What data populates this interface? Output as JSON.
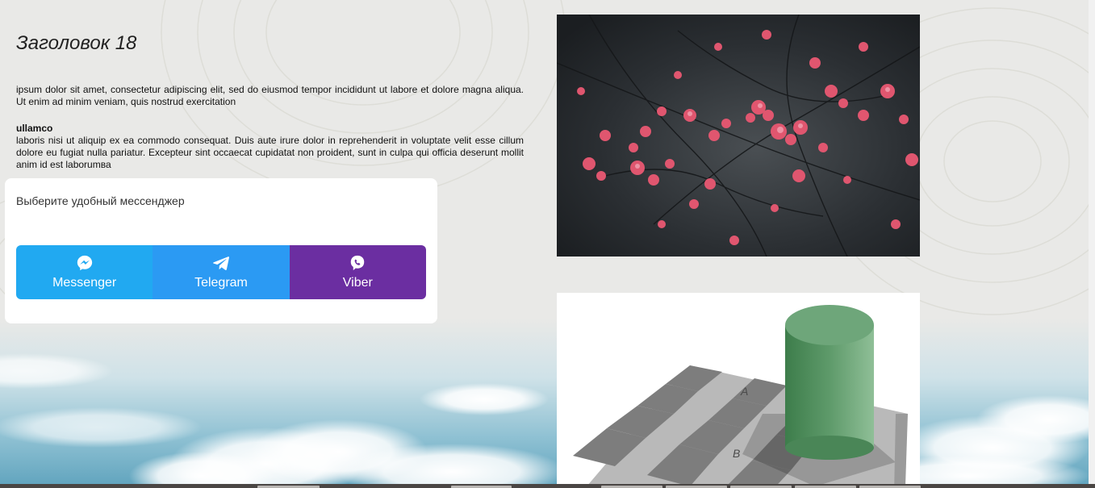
{
  "page": {
    "heading": "Заголовок 18",
    "paragraph1": "ipsum dolor sit amet, consectetur adipiscing elit, sed do eiusmod tempor incididunt ut labore et dolore magna aliqua. Ut enim ad minim veniam, quis nostrud exercitation",
    "subheading": "ullamco",
    "paragraph2": "laboris nisi ut aliquip ex ea commodo consequat. Duis aute irure dolor in reprehenderit in voluptate velit esse cillum dolore eu fugiat nulla pariatur. Excepteur sint occaecat cupidatat non proident, sunt in culpa qui officia deserunt mollit anim id est laborumва"
  },
  "messenger_widget": {
    "title": "Выберите удобный мессенджер",
    "buttons": [
      {
        "label": "Messenger",
        "icon": "messenger-icon",
        "color": "#21a9f1"
      },
      {
        "label": "Telegram",
        "icon": "telegram-icon",
        "color": "#2b9af3"
      },
      {
        "label": "Viber",
        "icon": "viber-icon",
        "color": "#6b2ea1"
      }
    ]
  },
  "images": {
    "photo1": "pink-blossoms-photo",
    "photo2": "checker-shadow-illusion",
    "illusion_labels": [
      "A",
      "B"
    ]
  },
  "colors": {
    "background": "#e9e9e7",
    "card": "#ffffff",
    "text": "#222222"
  }
}
